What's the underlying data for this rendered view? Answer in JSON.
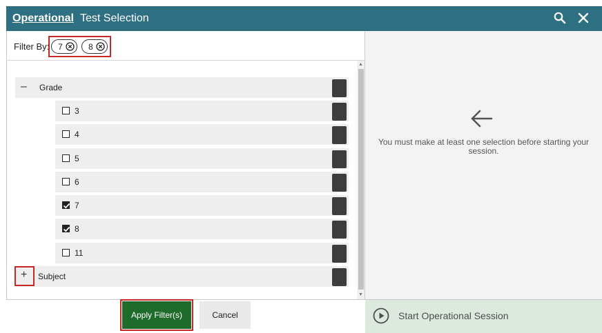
{
  "title": {
    "highlight": "Operational",
    "rest": "Test Selection"
  },
  "toolbar_icons": [
    "search-icon",
    "close-icon"
  ],
  "filter": {
    "label": "Filter By:",
    "chips": [
      "7",
      "8"
    ]
  },
  "tree": {
    "groups": [
      {
        "toggle": "–",
        "label": "Grade",
        "expanded": true,
        "items": [
          {
            "label": "3",
            "checked": false
          },
          {
            "label": "4",
            "checked": false
          },
          {
            "label": "5",
            "checked": false
          },
          {
            "label": "6",
            "checked": false
          },
          {
            "label": "7",
            "checked": true
          },
          {
            "label": "8",
            "checked": true
          },
          {
            "label": "11",
            "checked": false
          }
        ]
      },
      {
        "toggle": "+",
        "label": "Subject",
        "expanded": false,
        "items": []
      }
    ]
  },
  "buttons": {
    "apply": "Apply Filter(s)",
    "cancel": "Cancel"
  },
  "right_panel": {
    "message": "You must make at least one selection before starting your session.",
    "start_label": "Start Operational Session"
  },
  "colors": {
    "titlebar": "#2e6f82",
    "apply_button": "#1e6b2b",
    "highlight_outline": "#c62828",
    "start_bar": "#dde9de"
  }
}
